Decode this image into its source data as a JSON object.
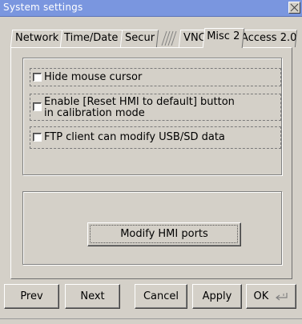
{
  "window": {
    "title": "System settings",
    "close_icon": "close-icon"
  },
  "tabs": [
    {
      "label": "Network",
      "active": false
    },
    {
      "label": "Time/Date",
      "active": false
    },
    {
      "label": "Secur",
      "active": false
    },
    {
      "label": "VNC",
      "active": false
    },
    {
      "label": "Misc 2",
      "active": true
    },
    {
      "label": "Access 2.0",
      "active": false
    }
  ],
  "options": [
    {
      "label": "Hide mouse cursor",
      "checked": false
    },
    {
      "label_line1": "Enable [Reset HMI to default] button",
      "label_line2": "in calibration mode",
      "checked": false
    },
    {
      "label": "FTP client can modify USB/SD data",
      "checked": false
    }
  ],
  "modify_ports_label": "Modify HMI ports",
  "footer": {
    "prev": "Prev",
    "next": "Next",
    "cancel": "Cancel",
    "apply": "Apply",
    "ok": "OK",
    "ok_icon": "enter-key-icon"
  }
}
